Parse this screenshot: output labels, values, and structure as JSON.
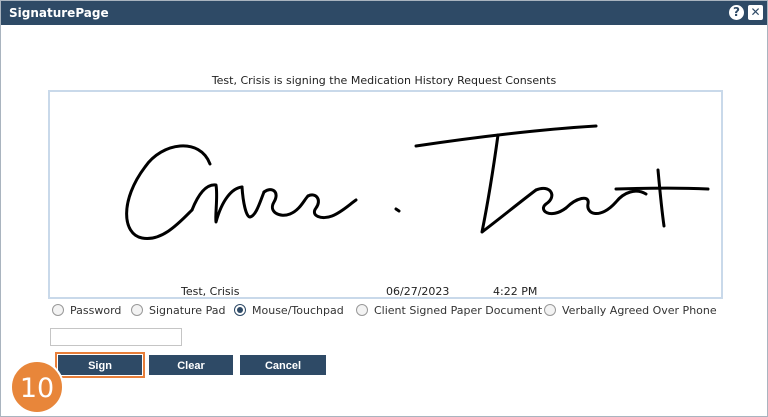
{
  "window": {
    "title": "SignaturePage",
    "help_label": "?",
    "close_label": "✕"
  },
  "prompt": "Test, Crisis is signing the Medication History Request Consents",
  "signature": {
    "signer_name": "Test, Crisis",
    "date": "06/27/2023",
    "time": "4:22 PM"
  },
  "methods": [
    {
      "label": "Password",
      "checked": false
    },
    {
      "label": "Signature Pad",
      "checked": false
    },
    {
      "label": "Mouse/Touchpad",
      "checked": true
    },
    {
      "label": "Client Signed Paper Document",
      "checked": false
    },
    {
      "label": "Verbally Agreed Over Phone",
      "checked": false
    }
  ],
  "password_input": {
    "value": "",
    "placeholder": ""
  },
  "buttons": {
    "sign": "Sign",
    "clear": "Clear",
    "cancel": "Cancel"
  },
  "step_badge": "10",
  "colors": {
    "titlebar": "#2e4a66",
    "button": "#2e4a66",
    "highlight": "#e87f3a",
    "badge": "#e8863a"
  }
}
